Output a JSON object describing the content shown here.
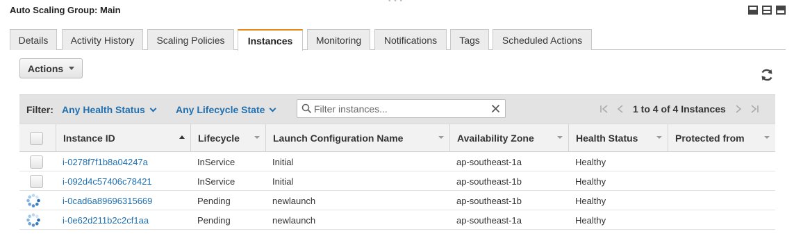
{
  "panel": {
    "title": "Auto Scaling Group: Main"
  },
  "tabs": [
    {
      "label": "Details"
    },
    {
      "label": "Activity History"
    },
    {
      "label": "Scaling Policies"
    },
    {
      "label": "Instances"
    },
    {
      "label": "Monitoring"
    },
    {
      "label": "Notifications"
    },
    {
      "label": "Tags"
    },
    {
      "label": "Scheduled Actions"
    }
  ],
  "active_tab": "Instances",
  "toolbar": {
    "actions_label": "Actions"
  },
  "filter": {
    "label": "Filter:",
    "health": "Any Health Status",
    "lifecycle": "Any Lifecycle State",
    "search_placeholder": "Filter instances...",
    "pagination": "1 to 4 of 4 Instances"
  },
  "table": {
    "columns": [
      "Instance ID",
      "Lifecycle",
      "Launch Configuration Name",
      "Availability Zone",
      "Health Status",
      "Protected from"
    ],
    "rows": [
      {
        "state": "idle",
        "id": "i-0278f7f1b8a04247a",
        "lifecycle": "InService",
        "launch_config": "Initial",
        "az": "ap-southeast-1a",
        "health": "Healthy",
        "protected": ""
      },
      {
        "state": "idle",
        "id": "i-092d4c57406c78421",
        "lifecycle": "InService",
        "launch_config": "Initial",
        "az": "ap-southeast-1b",
        "health": "Healthy",
        "protected": ""
      },
      {
        "state": "loading",
        "id": "i-0cad6a89696315669",
        "lifecycle": "Pending",
        "launch_config": "newlaunch",
        "az": "ap-southeast-1b",
        "health": "Healthy",
        "protected": ""
      },
      {
        "state": "loading",
        "id": "i-0e62d211b2c2cf1aa",
        "lifecycle": "Pending",
        "launch_config": "newlaunch",
        "az": "ap-southeast-1a",
        "health": "Healthy",
        "protected": ""
      }
    ]
  },
  "colors": {
    "accent": "#e88a19",
    "link": "#1f6fb0"
  },
  "icons": [
    "layout-bottom-icon",
    "layout-split-icon",
    "layout-top-icon",
    "refresh-icon",
    "search-icon",
    "clear-icon",
    "first-page-icon",
    "prev-page-icon",
    "next-page-icon",
    "last-page-icon",
    "loading-spinner-icon",
    "checkbox"
  ]
}
